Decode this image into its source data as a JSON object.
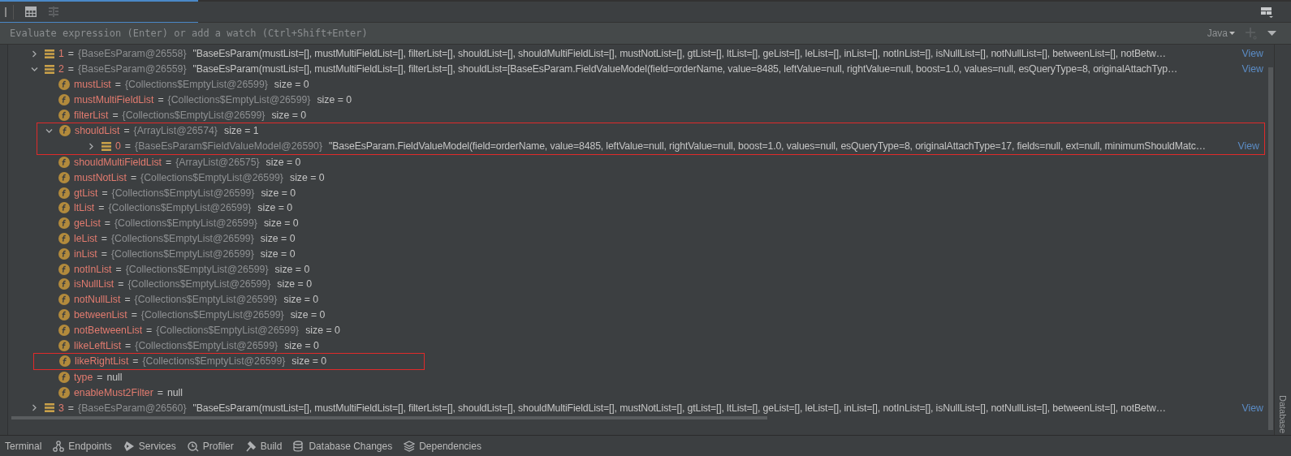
{
  "assign_sign": "=",
  "expression_field": {
    "placeholder": "Evaluate expression (Enter) or add a watch (Ctrl+Shift+Enter)",
    "language": "Java"
  },
  "tree": [
    {
      "kind": "element",
      "name": "1",
      "type": "{BaseEsParam@26558}",
      "value": "\"BaseEsParam(mustList=[], mustMultiFieldList=[], filterList=[], shouldList=[], shouldMultiFieldList=[], mustNotList=[], gtList=[], ltList=[], geList=[], leList=[], inList=[], notInList=[], isNullList=[], notNullList=[], betweenList=[], notBetw…",
      "link": "View",
      "expanded": false,
      "highlighted": false
    },
    {
      "kind": "element",
      "name": "2",
      "type": "{BaseEsParam@26559}",
      "value": "\"BaseEsParam(mustList=[], mustMultiFieldList=[], filterList=[], shouldList=[BaseEsParam.FieldValueModel(field=orderName, value=8485, leftValue=null, rightValue=null, boost=1.0, values=null, esQueryType=8, originalAttachTyp…",
      "link": "View",
      "expanded": true,
      "highlighted": false,
      "children": [
        {
          "kind": "field",
          "name": "mustList",
          "type": "{Collections$EmptyList@26599}",
          "size": "size = 0",
          "highlighted": false
        },
        {
          "kind": "field",
          "name": "mustMultiFieldList",
          "type": "{Collections$EmptyList@26599}",
          "size": "size = 0",
          "highlighted": false
        },
        {
          "kind": "field",
          "name": "filterList",
          "type": "{Collections$EmptyList@26599}",
          "size": "size = 0",
          "highlighted": false
        },
        {
          "kind": "field",
          "name": "shouldList",
          "type": "{ArrayList@26574}",
          "size": "size = 1",
          "expanded": true,
          "highlighted": true,
          "children": [
            {
              "kind": "element",
              "name": "0",
              "type": "{BaseEsParam$FieldValueModel@26590}",
              "value": "\"BaseEsParam.FieldValueModel(field=orderName, value=8485, leftValue=null, rightValue=null, boost=1.0, values=null, esQueryType=8, originalAttachType=17, fields=null, ext=null, minimumShouldMatc…",
              "link": "View",
              "expanded": false,
              "highlighted": false
            }
          ]
        },
        {
          "kind": "field",
          "name": "shouldMultiFieldList",
          "type": "{ArrayList@26575}",
          "size": "size = 0",
          "highlighted": false
        },
        {
          "kind": "field",
          "name": "mustNotList",
          "type": "{Collections$EmptyList@26599}",
          "size": "size = 0",
          "highlighted": false
        },
        {
          "kind": "field",
          "name": "gtList",
          "type": "{Collections$EmptyList@26599}",
          "size": "size = 0",
          "highlighted": false
        },
        {
          "kind": "field",
          "name": "ltList",
          "type": "{Collections$EmptyList@26599}",
          "size": "size = 0",
          "highlighted": false
        },
        {
          "kind": "field",
          "name": "geList",
          "type": "{Collections$EmptyList@26599}",
          "size": "size = 0",
          "highlighted": false
        },
        {
          "kind": "field",
          "name": "leList",
          "type": "{Collections$EmptyList@26599}",
          "size": "size = 0",
          "highlighted": false
        },
        {
          "kind": "field",
          "name": "inList",
          "type": "{Collections$EmptyList@26599}",
          "size": "size = 0",
          "highlighted": false
        },
        {
          "kind": "field",
          "name": "notInList",
          "type": "{Collections$EmptyList@26599}",
          "size": "size = 0",
          "highlighted": false
        },
        {
          "kind": "field",
          "name": "isNullList",
          "type": "{Collections$EmptyList@26599}",
          "size": "size = 0",
          "highlighted": false
        },
        {
          "kind": "field",
          "name": "notNullList",
          "type": "{Collections$EmptyList@26599}",
          "size": "size = 0",
          "highlighted": false
        },
        {
          "kind": "field",
          "name": "betweenList",
          "type": "{Collections$EmptyList@26599}",
          "size": "size = 0",
          "highlighted": false
        },
        {
          "kind": "field",
          "name": "notBetweenList",
          "type": "{Collections$EmptyList@26599}",
          "size": "size = 0",
          "highlighted": false
        },
        {
          "kind": "field",
          "name": "likeLeftList",
          "type": "{Collections$EmptyList@26599}",
          "size": "size = 0",
          "highlighted": false
        },
        {
          "kind": "field",
          "name": "likeRightList",
          "type": "{Collections$EmptyList@26599}",
          "size": "size = 0",
          "highlighted": true
        },
        {
          "kind": "field",
          "name": "type",
          "value": "null",
          "highlighted": false
        },
        {
          "kind": "field",
          "name": "enableMust2Filter",
          "value": "null",
          "highlighted": false
        }
      ]
    },
    {
      "kind": "element",
      "name": "3",
      "type": "{BaseEsParam@26560}",
      "value": "\"BaseEsParam(mustList=[], mustMultiFieldList=[], filterList=[], shouldList=[], shouldMultiFieldList=[], mustNotList=[], gtList=[], ltList=[], geList=[], leList=[], inList=[], notInList=[], isNullList=[], notNullList=[], betweenList=[], notBetw…",
      "link": "View",
      "expanded": false,
      "highlighted": false
    }
  ],
  "side_panel": "Database",
  "bottom_tabs": [
    {
      "kind": "terminal",
      "label": "Terminal"
    },
    {
      "kind": "endpoints",
      "label": "Endpoints"
    },
    {
      "kind": "services",
      "label": "Services"
    },
    {
      "kind": "profiler",
      "label": "Profiler"
    },
    {
      "kind": "build",
      "label": "Build"
    },
    {
      "kind": "database",
      "label": "Database Changes"
    },
    {
      "kind": "dependencies",
      "label": "Dependencies"
    }
  ]
}
